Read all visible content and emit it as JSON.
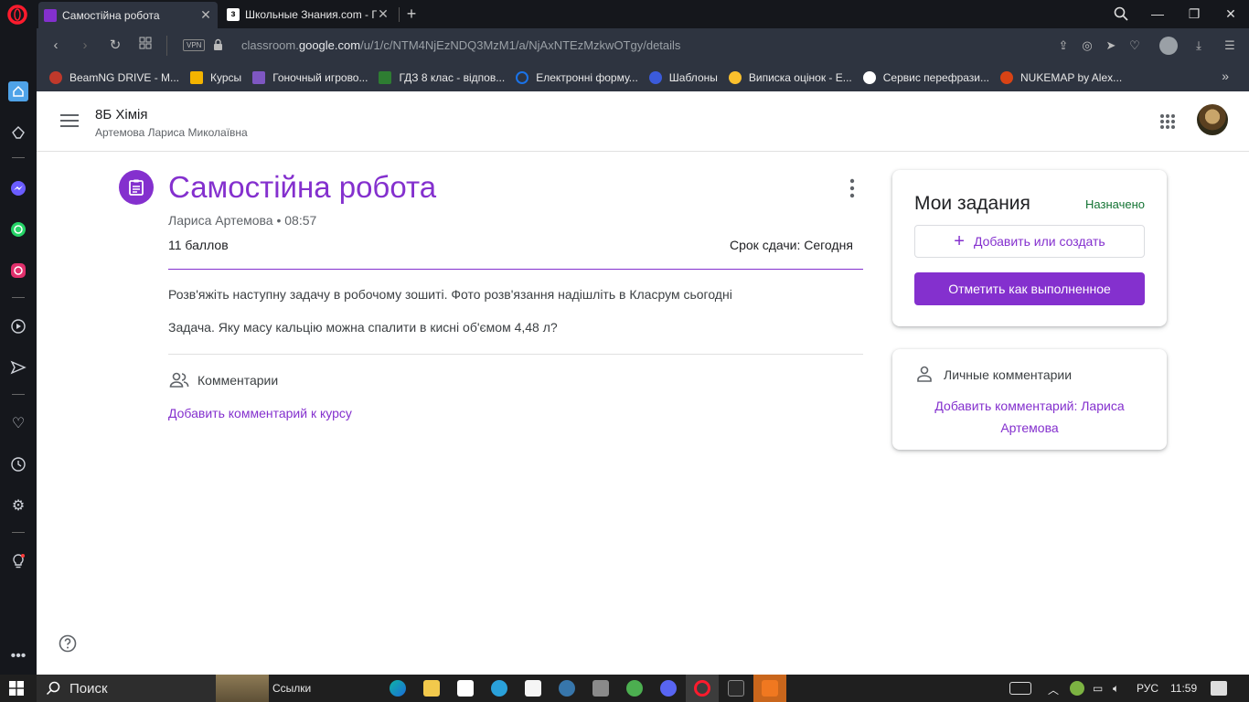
{
  "browser": {
    "tabs": [
      {
        "title": "Самостійна робота",
        "favicon_color": "#8430ce"
      },
      {
        "title": "Школьные Знания.com - Г",
        "favicon_color": "#ffffff"
      }
    ],
    "address": {
      "vpn_label": "VPN",
      "url_prefix": "classroom.",
      "url_host": "google.com",
      "url_path": "/u/1/c/NTM4NjEzNDQ3MzM1/a/NjAxNTEzMzkwOTgy/details"
    },
    "bookmarks": [
      {
        "label": "BeamNG DRIVE - M...",
        "color": "#c0392b"
      },
      {
        "label": "Курсы",
        "color": "#f4b400"
      },
      {
        "label": "Гоночный игрово...",
        "color": "#7e57c2"
      },
      {
        "label": "ГДЗ 8 клас - відпов...",
        "color": "#2e7d32"
      },
      {
        "label": "Електронні форму...",
        "color": "#1a73e8"
      },
      {
        "label": "Шаблоны",
        "color": "#3b5bdb"
      },
      {
        "label": "Виписка оцінок - Е...",
        "color": "#fbc02d"
      },
      {
        "label": "Сервис перефрази...",
        "color": "#ffffff"
      },
      {
        "label": "NUKEMAP by Alex...",
        "color": "#d84315"
      }
    ]
  },
  "classroom": {
    "class_name": "8Б Хімія",
    "teacher": "Артемова Лариса Миколаївна",
    "assignment": {
      "title": "Самостійна робота",
      "author_time": "Лариса Артемова • 08:57",
      "points": "11 баллов",
      "due": "Срок сдачи: Сегодня",
      "description": [
        "Розв'яжіть наступну задачу в робочому зошиті. Фото розв'язання надішліть в Класрум сьогодні",
        "Задача. Яку масу кальцію можна спалити в кисні об'ємом 4,48 л?"
      ],
      "comments_title": "Комментарии",
      "add_comment": "Добавить комментарий к курсу"
    },
    "my_work": {
      "title": "Мои задания",
      "status": "Назначено",
      "add_button": "Добавить или создать",
      "mark_button": "Отметить как выполненное"
    },
    "private_comments": {
      "title": "Личные комментарии",
      "add_link": "Добавить комментарий: Лариса Артемова"
    }
  },
  "taskbar": {
    "search_label": "Поиск",
    "links_label": "Ссылки",
    "language": "РУС",
    "time": "11:59"
  },
  "colors": {
    "accent": "#8430ce",
    "status_green": "#137333"
  }
}
